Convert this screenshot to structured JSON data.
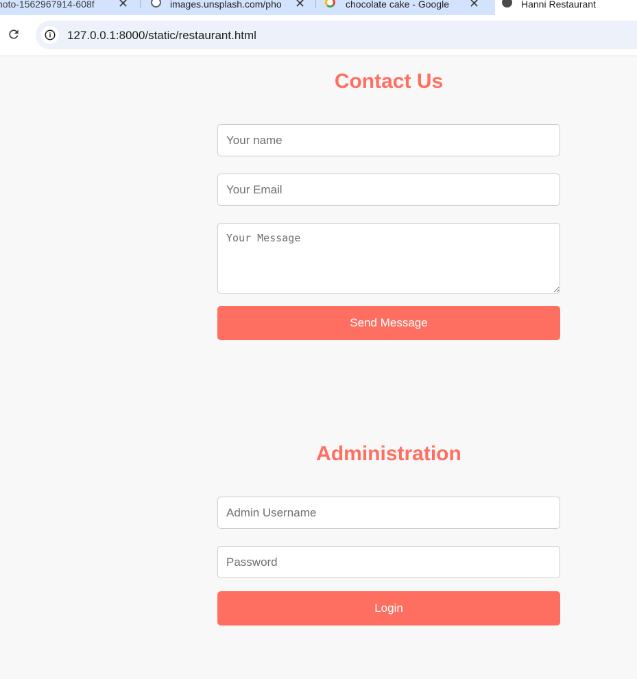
{
  "browser": {
    "tabs": [
      {
        "title": "hoto-1562967914-608f",
        "favicon": "none",
        "active": false
      },
      {
        "title": "images.unsplash.com/pho",
        "favicon": "globe-icon",
        "active": false
      },
      {
        "title": "chocolate cake - Google",
        "favicon": "google-icon",
        "active": false
      },
      {
        "title": "Hanni Restaurant",
        "favicon": "globe-icon",
        "active": true
      }
    ],
    "close_glyph": "✕",
    "url": "127.0.0.1:8000/static/restaurant.html"
  },
  "contact": {
    "title": "Contact Us",
    "name_placeholder": "Your name",
    "email_placeholder": "Your Email",
    "message_placeholder": "Your Message",
    "send_label": "Send Message"
  },
  "admin": {
    "title": "Administration",
    "username_placeholder": "Admin Username",
    "password_placeholder": "Password",
    "login_label": "Login"
  },
  "colors": {
    "accent": "#ff6f61",
    "page_background": "#f8f8f8",
    "tabstrip": "#d3e3fd",
    "omnibox": "#edf2fa"
  }
}
